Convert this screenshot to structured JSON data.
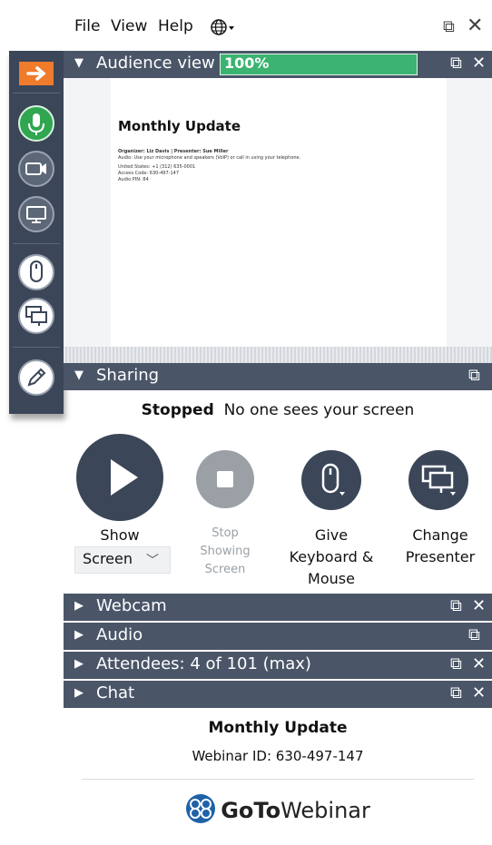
{
  "menu": {
    "file": "File",
    "view": "View",
    "help": "Help"
  },
  "audience": {
    "header_label": "Audience view",
    "zoom_value": "100%",
    "doc_title": "Monthly Update",
    "doc_lines": [
      "Organizer: Liz Davis | Presenter: Sue Miller",
      "Audio: Use your microphone and speakers (VoIP) or call in using your telephone.",
      "United States: +1 (312) 635-0001",
      "Access Code: 630-497-147",
      "Audio PIN: 84"
    ]
  },
  "sharing": {
    "header_label": "Sharing",
    "status_strong": "Stopped",
    "status_rest": "No one sees your screen",
    "show_label": "Show",
    "show_select": "Screen",
    "stop_label_1": "Stop",
    "stop_label_2": "Showing",
    "stop_label_3": "Screen",
    "give_label_1": "Give",
    "give_label_2": "Keyboard &",
    "give_label_3": "Mouse",
    "change_label_1": "Change",
    "change_label_2": "Presenter"
  },
  "panels": {
    "webcam": "Webcam",
    "audio": "Audio",
    "attendees": "Attendees:  4 of 101 (max)",
    "chat": "Chat"
  },
  "footer": {
    "webinar_title": "Monthly Update",
    "webinar_id": "Webinar ID: 630-497-147",
    "brand_goto": "GoTo",
    "brand_webinar": "Webinar"
  },
  "colors": {
    "header_bg": "#4a5568",
    "toolbar_bg": "#3b4658",
    "accent_orange": "#f07b2b",
    "mic_green": "#2fa64f",
    "zoom_green": "#3cb371",
    "brand_blue": "#1f62a8"
  },
  "icons": [
    "arrow-right-icon",
    "microphone-icon",
    "webcam-icon",
    "screen-icon",
    "mouse-icon",
    "change-presenter-icon",
    "pen-icon",
    "globe-icon",
    "undock-icon",
    "close-icon",
    "play-icon",
    "stop-icon",
    "gotowebinar-logo-icon"
  ]
}
